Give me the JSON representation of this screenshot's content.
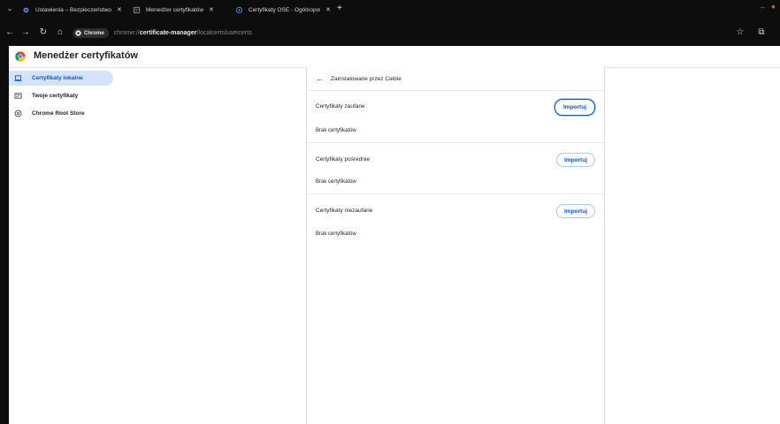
{
  "browser": {
    "tabs": [
      {
        "title": "Ustawienia – Bezpieczeństwo",
        "icon": "gear-icon"
      },
      {
        "title": "Menedżer certyfikatów",
        "icon": "certificate-icon"
      },
      {
        "title": "Certyfikaty OSE - Ogólnopolski",
        "icon": "page-icon"
      }
    ],
    "omnibox": {
      "chip_label": "Chrome",
      "url_scheme": "chrome://",
      "url_host": "certificate-manager",
      "url_path": "/localcerts/usercerts"
    }
  },
  "page": {
    "title": "Menedżer certyfikatów"
  },
  "sidebar": {
    "items": [
      {
        "label": "Certyfikaty lokalne",
        "icon": "laptop-icon",
        "active": true
      },
      {
        "label": "Twoje certyfikaty",
        "icon": "id-card-icon",
        "active": false
      },
      {
        "label": "Chrome Root Store",
        "icon": "shield-icon",
        "active": false
      }
    ]
  },
  "main": {
    "back_label": "Zainstalowane przez Ciebie",
    "sections": [
      {
        "title": "Certyfikaty zaufane",
        "button": "Importuj",
        "empty": "Brak certyfikatów"
      },
      {
        "title": "Certyfikaty pośrednie",
        "button": "Importuj",
        "empty": "Brak certyfikatów"
      },
      {
        "title": "Certyfikaty niezaufane",
        "button": "Importuj",
        "empty": "Brak certyfikatów"
      }
    ]
  },
  "colors": {
    "accent": "#0b57d0",
    "active_nav_bg": "#d3e3fd",
    "chrome_frame": "#0d0d0d"
  }
}
